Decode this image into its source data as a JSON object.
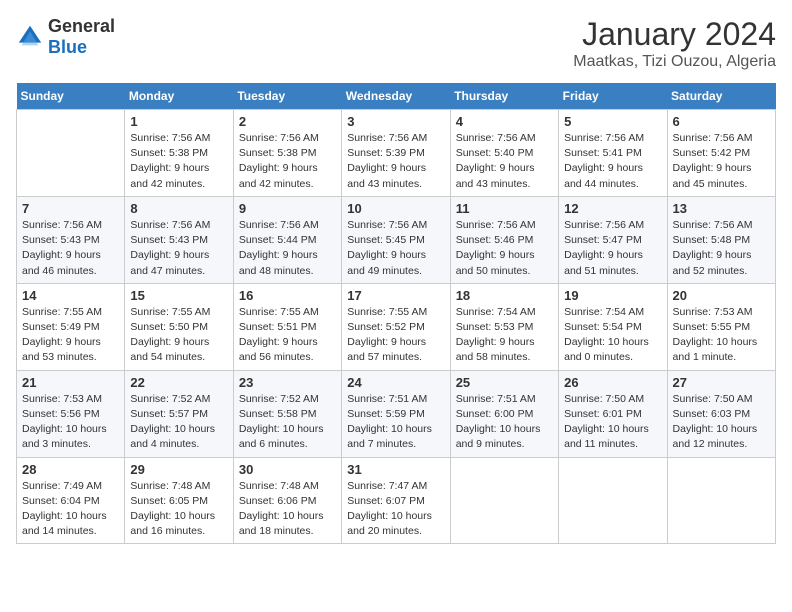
{
  "header": {
    "logo": {
      "text_general": "General",
      "text_blue": "Blue"
    },
    "title": "January 2024",
    "subtitle": "Maatkas, Tizi Ouzou, Algeria"
  },
  "calendar": {
    "weekdays": [
      "Sunday",
      "Monday",
      "Tuesday",
      "Wednesday",
      "Thursday",
      "Friday",
      "Saturday"
    ],
    "weeks": [
      [
        {
          "day": "",
          "info": ""
        },
        {
          "day": "1",
          "info": "Sunrise: 7:56 AM\nSunset: 5:38 PM\nDaylight: 9 hours\nand 42 minutes."
        },
        {
          "day": "2",
          "info": "Sunrise: 7:56 AM\nSunset: 5:38 PM\nDaylight: 9 hours\nand 42 minutes."
        },
        {
          "day": "3",
          "info": "Sunrise: 7:56 AM\nSunset: 5:39 PM\nDaylight: 9 hours\nand 43 minutes."
        },
        {
          "day": "4",
          "info": "Sunrise: 7:56 AM\nSunset: 5:40 PM\nDaylight: 9 hours\nand 43 minutes."
        },
        {
          "day": "5",
          "info": "Sunrise: 7:56 AM\nSunset: 5:41 PM\nDaylight: 9 hours\nand 44 minutes."
        },
        {
          "day": "6",
          "info": "Sunrise: 7:56 AM\nSunset: 5:42 PM\nDaylight: 9 hours\nand 45 minutes."
        }
      ],
      [
        {
          "day": "7",
          "info": "Sunrise: 7:56 AM\nSunset: 5:43 PM\nDaylight: 9 hours\nand 46 minutes."
        },
        {
          "day": "8",
          "info": "Sunrise: 7:56 AM\nSunset: 5:43 PM\nDaylight: 9 hours\nand 47 minutes."
        },
        {
          "day": "9",
          "info": "Sunrise: 7:56 AM\nSunset: 5:44 PM\nDaylight: 9 hours\nand 48 minutes."
        },
        {
          "day": "10",
          "info": "Sunrise: 7:56 AM\nSunset: 5:45 PM\nDaylight: 9 hours\nand 49 minutes."
        },
        {
          "day": "11",
          "info": "Sunrise: 7:56 AM\nSunset: 5:46 PM\nDaylight: 9 hours\nand 50 minutes."
        },
        {
          "day": "12",
          "info": "Sunrise: 7:56 AM\nSunset: 5:47 PM\nDaylight: 9 hours\nand 51 minutes."
        },
        {
          "day": "13",
          "info": "Sunrise: 7:56 AM\nSunset: 5:48 PM\nDaylight: 9 hours\nand 52 minutes."
        }
      ],
      [
        {
          "day": "14",
          "info": "Sunrise: 7:55 AM\nSunset: 5:49 PM\nDaylight: 9 hours\nand 53 minutes."
        },
        {
          "day": "15",
          "info": "Sunrise: 7:55 AM\nSunset: 5:50 PM\nDaylight: 9 hours\nand 54 minutes."
        },
        {
          "day": "16",
          "info": "Sunrise: 7:55 AM\nSunset: 5:51 PM\nDaylight: 9 hours\nand 56 minutes."
        },
        {
          "day": "17",
          "info": "Sunrise: 7:55 AM\nSunset: 5:52 PM\nDaylight: 9 hours\nand 57 minutes."
        },
        {
          "day": "18",
          "info": "Sunrise: 7:54 AM\nSunset: 5:53 PM\nDaylight: 9 hours\nand 58 minutes."
        },
        {
          "day": "19",
          "info": "Sunrise: 7:54 AM\nSunset: 5:54 PM\nDaylight: 10 hours\nand 0 minutes."
        },
        {
          "day": "20",
          "info": "Sunrise: 7:53 AM\nSunset: 5:55 PM\nDaylight: 10 hours\nand 1 minute."
        }
      ],
      [
        {
          "day": "21",
          "info": "Sunrise: 7:53 AM\nSunset: 5:56 PM\nDaylight: 10 hours\nand 3 minutes."
        },
        {
          "day": "22",
          "info": "Sunrise: 7:52 AM\nSunset: 5:57 PM\nDaylight: 10 hours\nand 4 minutes."
        },
        {
          "day": "23",
          "info": "Sunrise: 7:52 AM\nSunset: 5:58 PM\nDaylight: 10 hours\nand 6 minutes."
        },
        {
          "day": "24",
          "info": "Sunrise: 7:51 AM\nSunset: 5:59 PM\nDaylight: 10 hours\nand 7 minutes."
        },
        {
          "day": "25",
          "info": "Sunrise: 7:51 AM\nSunset: 6:00 PM\nDaylight: 10 hours\nand 9 minutes."
        },
        {
          "day": "26",
          "info": "Sunrise: 7:50 AM\nSunset: 6:01 PM\nDaylight: 10 hours\nand 11 minutes."
        },
        {
          "day": "27",
          "info": "Sunrise: 7:50 AM\nSunset: 6:03 PM\nDaylight: 10 hours\nand 12 minutes."
        }
      ],
      [
        {
          "day": "28",
          "info": "Sunrise: 7:49 AM\nSunset: 6:04 PM\nDaylight: 10 hours\nand 14 minutes."
        },
        {
          "day": "29",
          "info": "Sunrise: 7:48 AM\nSunset: 6:05 PM\nDaylight: 10 hours\nand 16 minutes."
        },
        {
          "day": "30",
          "info": "Sunrise: 7:48 AM\nSunset: 6:06 PM\nDaylight: 10 hours\nand 18 minutes."
        },
        {
          "day": "31",
          "info": "Sunrise: 7:47 AM\nSunset: 6:07 PM\nDaylight: 10 hours\nand 20 minutes."
        },
        {
          "day": "",
          "info": ""
        },
        {
          "day": "",
          "info": ""
        },
        {
          "day": "",
          "info": ""
        }
      ]
    ]
  }
}
